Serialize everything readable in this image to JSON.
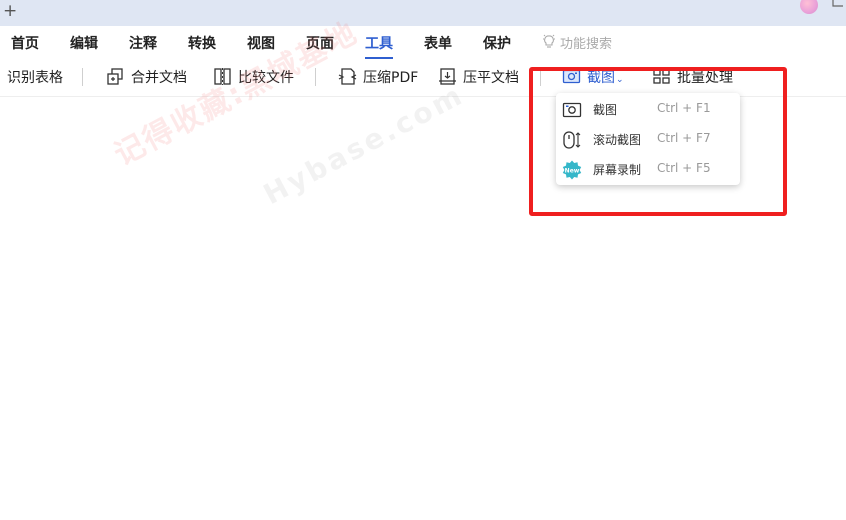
{
  "titlebar": {
    "new_tab_symbol": "+"
  },
  "menu": {
    "items": [
      {
        "label": "首页"
      },
      {
        "label": "编辑"
      },
      {
        "label": "注释"
      },
      {
        "label": "转换"
      },
      {
        "label": "视图"
      },
      {
        "label": "页面"
      },
      {
        "label": "工具",
        "active": true
      },
      {
        "label": "表单"
      },
      {
        "label": "保护"
      }
    ],
    "search_label": "功能搜索"
  },
  "toolbar": {
    "recognize_table": "识别表格",
    "merge_docs": "合并文档",
    "compare_files": "比较文件",
    "compress_pdf": "压缩PDF",
    "flatten_doc": "压平文档",
    "screenshot": "截图",
    "batch_process": "批量处理"
  },
  "dropdown": {
    "items": [
      {
        "label": "截图",
        "shortcut": "Ctrl + F1",
        "icon": "camera-icon"
      },
      {
        "label": "滚动截图",
        "shortcut": "Ctrl + F7",
        "icon": "scroll-mouse-icon"
      },
      {
        "label": "屏幕录制",
        "shortcut": "Ctrl + F5",
        "icon": "new-badge-icon"
      }
    ]
  },
  "watermark": {
    "text": "记得收藏:黑域基地",
    "domain": "Hybase.com"
  },
  "colors": {
    "accent": "#2f5fd0",
    "highlight_border": "#ef1f1f",
    "titlebar": "#dfe6f3"
  }
}
